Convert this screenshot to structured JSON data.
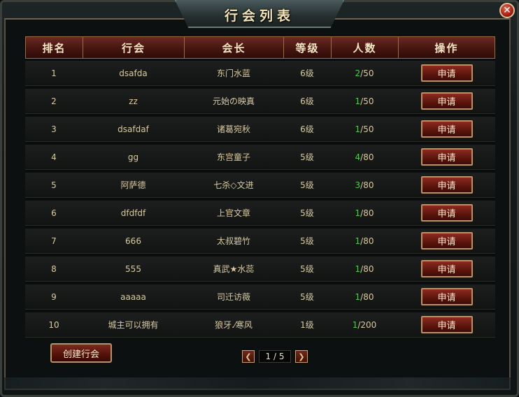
{
  "window": {
    "title": "行会列表"
  },
  "colors": {
    "accent_gold": "#d8c9a1",
    "member_green": "#49d048",
    "button_red": "#8c2b20"
  },
  "icons": {
    "close": "close-icon",
    "prev": "chevron-left-icon",
    "next": "chevron-right-icon"
  },
  "table": {
    "headers": [
      "排名",
      "行会",
      "会长",
      "等级",
      "人数",
      "操作"
    ],
    "rows": [
      {
        "rank": "1",
        "guild": "dsafda",
        "leader": "东门水蓝",
        "level": "6级",
        "cur": "2",
        "tot": "/50",
        "action": "申请"
      },
      {
        "rank": "2",
        "guild": "zz",
        "leader": "元始の映真",
        "level": "6级",
        "cur": "1",
        "tot": "/50",
        "action": "申请"
      },
      {
        "rank": "3",
        "guild": "dsafdaf",
        "leader": "诸葛宛秋",
        "level": "6级",
        "cur": "1",
        "tot": "/50",
        "action": "申请"
      },
      {
        "rank": "4",
        "guild": "gg",
        "leader": "东宫童子",
        "level": "5级",
        "cur": "4",
        "tot": "/80",
        "action": "申请"
      },
      {
        "rank": "5",
        "guild": "阿萨德",
        "leader": "七杀◇文进",
        "level": "5级",
        "cur": "3",
        "tot": "/80",
        "action": "申请"
      },
      {
        "rank": "6",
        "guild": "dfdfdf",
        "leader": "上官文章",
        "level": "5级",
        "cur": "1",
        "tot": "/80",
        "action": "申请"
      },
      {
        "rank": "7",
        "guild": "666",
        "leader": "太叔碧竹",
        "level": "5级",
        "cur": "1",
        "tot": "/80",
        "action": "申请"
      },
      {
        "rank": "8",
        "guild": "555",
        "leader": "真武★水蕊",
        "level": "5级",
        "cur": "1",
        "tot": "/80",
        "action": "申请"
      },
      {
        "rank": "9",
        "guild": "aaaaa",
        "leader": "司迁访薇",
        "level": "5级",
        "cur": "1",
        "tot": "/80",
        "action": "申请"
      },
      {
        "rank": "10",
        "guild": "城主可以拥有",
        "leader": "狼牙.⁄寒风",
        "level": "1级",
        "cur": "1",
        "tot": "/200",
        "action": "申请"
      }
    ]
  },
  "footer": {
    "create_label": "创建行会",
    "page": "1 / 5"
  }
}
